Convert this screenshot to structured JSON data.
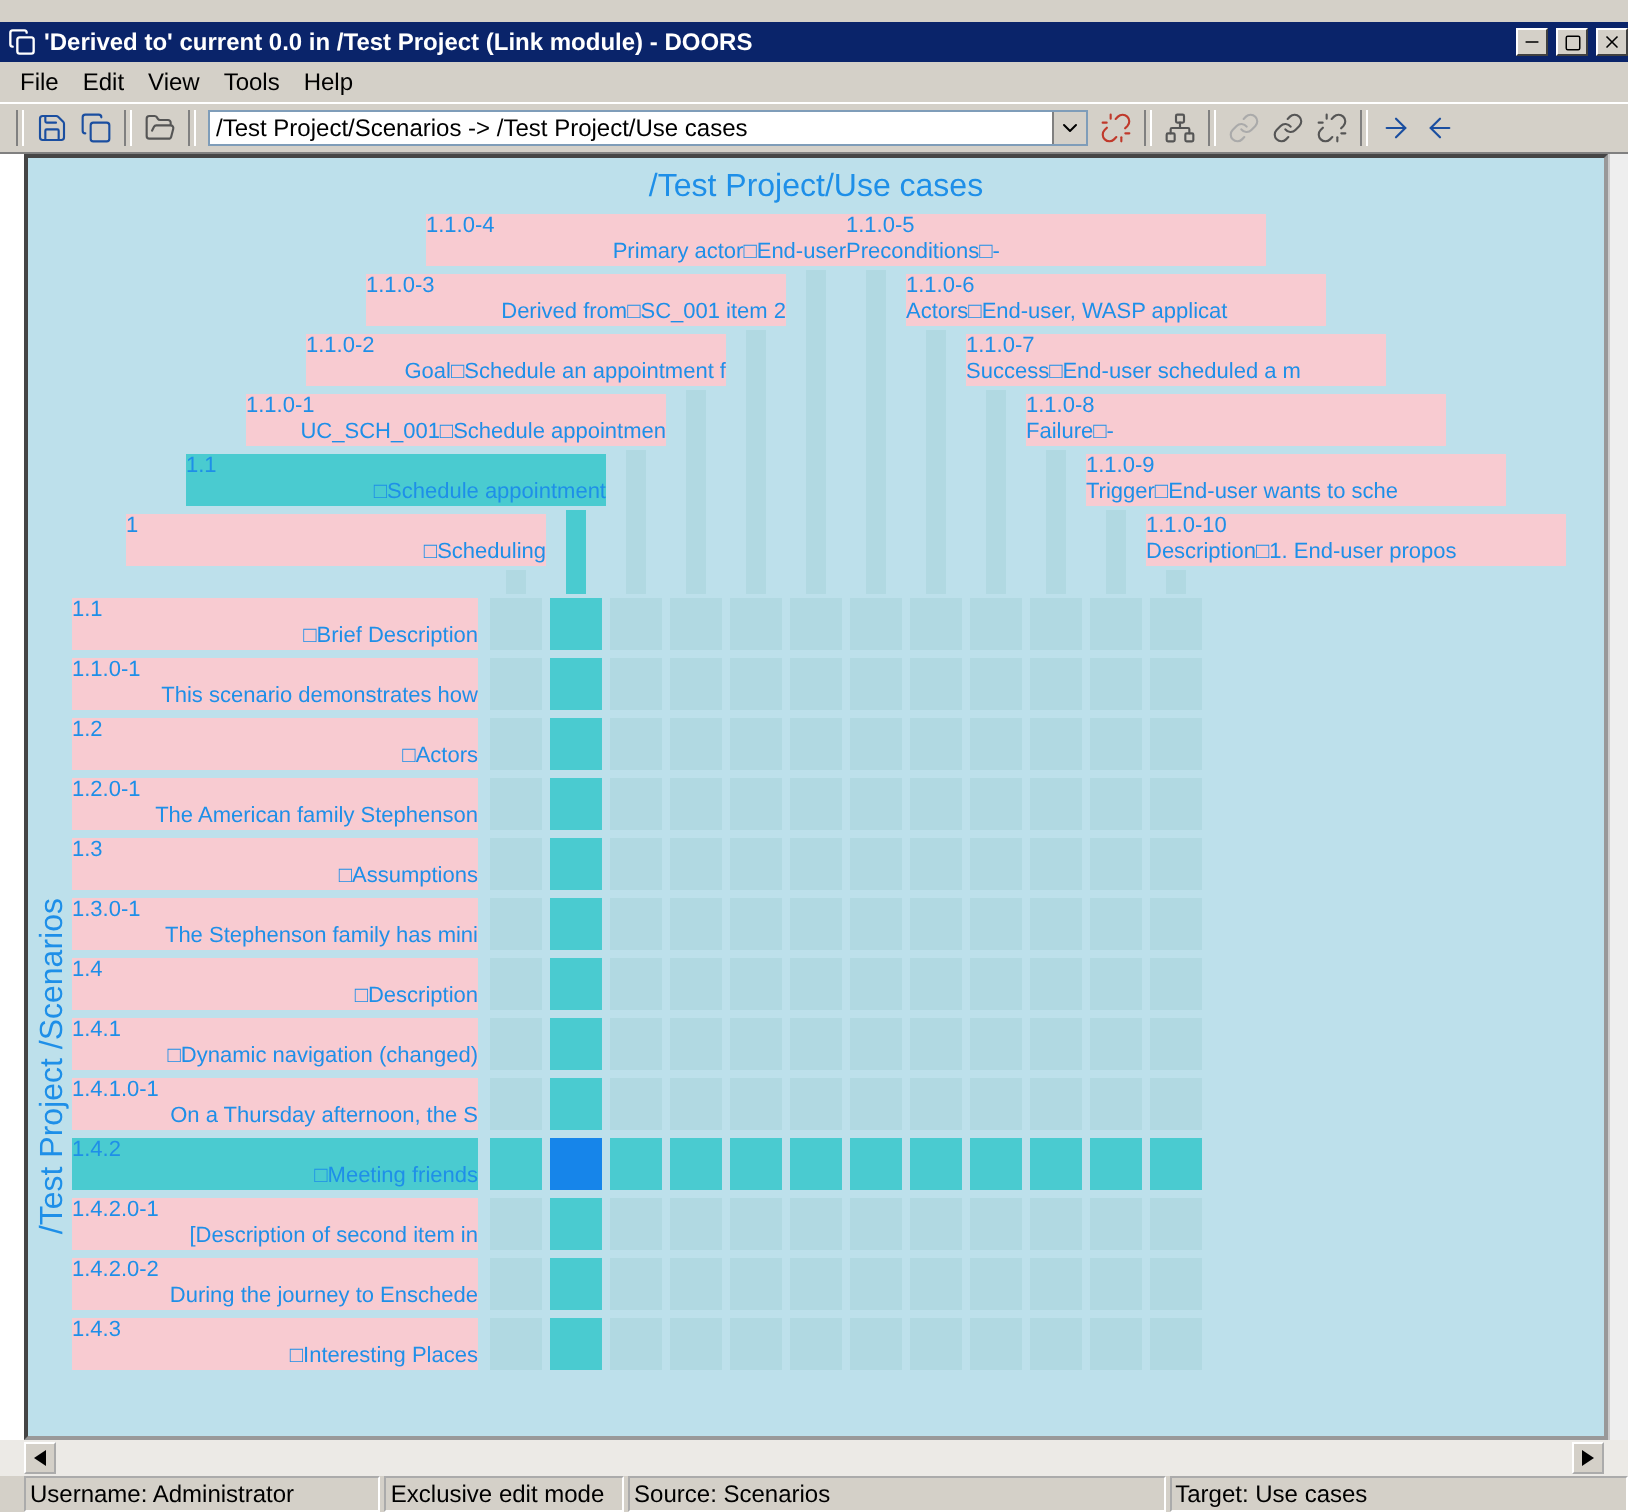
{
  "window": {
    "title": "'Derived to' current 0.0 in /Test Project (Link module) - DOORS"
  },
  "menu": [
    {
      "label": "File"
    },
    {
      "label": "Edit"
    },
    {
      "label": "View"
    },
    {
      "label": "Tools"
    },
    {
      "label": "Help"
    }
  ],
  "toolbar": {
    "path": "/Test Project/Scenarios -> /Test Project/Use cases"
  },
  "matrix": {
    "target_title": "/Test Project/Use cases",
    "source_title": "/Test Project /Scenarios",
    "columns": [
      {
        "id": "1.1.0-4",
        "text": "Primary actor□End-user",
        "selected": false
      },
      {
        "id": "1.1.0-5",
        "text": "Preconditions□-",
        "selected": false
      },
      {
        "id": "1.1.0-3",
        "text": "Derived from□SC_001 item 2",
        "selected": false
      },
      {
        "id": "1.1.0-6",
        "text": "Actors□End-user, WASP applicat",
        "selected": false
      },
      {
        "id": "1.1.0-2",
        "text": "Goal□Schedule an appointment f",
        "selected": false
      },
      {
        "id": "1.1.0-7",
        "text": "Success□End-user scheduled a m",
        "selected": false
      },
      {
        "id": "1.1.0-1",
        "text": "UC_SCH_001□Schedule appointmen",
        "selected": false
      },
      {
        "id": "1.1.0-8",
        "text": "Failure□-",
        "selected": false
      },
      {
        "id": "1.1",
        "text": "□Schedule appointment",
        "selected": true
      },
      {
        "id": "1.1.0-9",
        "text": "Trigger□End-user wants to sche",
        "selected": false
      },
      {
        "id": "1",
        "text": "□Scheduling",
        "selected": false
      },
      {
        "id": "1.1.0-10",
        "text": "Description□1. End-user propos",
        "selected": false
      }
    ],
    "rows": [
      {
        "id": "1.1",
        "text": "□Brief Description",
        "selected": false
      },
      {
        "id": "1.1.0-1",
        "text": "This scenario demonstrates how",
        "selected": false
      },
      {
        "id": "1.2",
        "text": "□Actors",
        "selected": false
      },
      {
        "id": "1.2.0-1",
        "text": "The American family Stephenson",
        "selected": false
      },
      {
        "id": "1.3",
        "text": "□Assumptions",
        "selected": false
      },
      {
        "id": "1.3.0-1",
        "text": "The Stephenson family has mini",
        "selected": false
      },
      {
        "id": "1.4",
        "text": "□Description",
        "selected": false
      },
      {
        "id": "1.4.1",
        "text": "□Dynamic navigation (changed)",
        "selected": false
      },
      {
        "id": "1.4.1.0-1",
        "text": "On a Thursday afternoon, the S",
        "selected": false
      },
      {
        "id": "1.4.2",
        "text": "□Meeting friends",
        "selected": true
      },
      {
        "id": "1.4.2.0-1",
        "text": "[Description of second item in",
        "selected": false
      },
      {
        "id": "1.4.2.0-2",
        "text": "During the journey to Enschede",
        "selected": false
      },
      {
        "id": "1.4.3",
        "text": "□Interesting Places",
        "selected": false
      }
    ]
  },
  "status_bar": [
    {
      "text": "Username: Administrator"
    },
    {
      "text": "Exclusive edit mode"
    },
    {
      "text": "Source: Scenarios"
    },
    {
      "text": "Target: Use cases"
    }
  ]
}
